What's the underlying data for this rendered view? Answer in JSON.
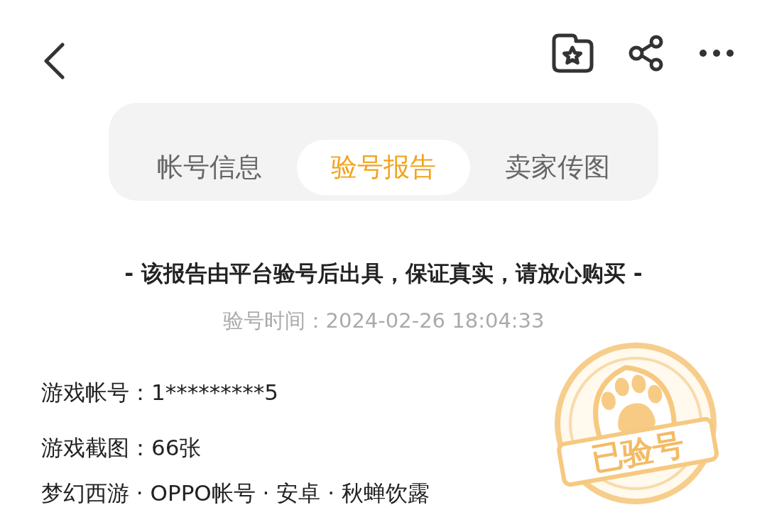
{
  "tabs": [
    {
      "label": "帐号信息",
      "selected": false
    },
    {
      "label": "验号报告",
      "selected": true
    },
    {
      "label": "卖家传图",
      "selected": false
    }
  ],
  "report": {
    "notice": "- 该报告由平台验号后出具，保证真实，请放心购买 -",
    "time_label": "验号时间：",
    "time_value": "2024-02-26 18:04:33",
    "fields": [
      {
        "label": "游戏帐号：",
        "value": "1*********5"
      },
      {
        "label": "游戏截图：",
        "value": "66张"
      }
    ],
    "summary": "梦幻西游 · OPPO帐号 · 安卓 · 秋蝉饮露",
    "stamp": {
      "text": "已验号"
    }
  }
}
